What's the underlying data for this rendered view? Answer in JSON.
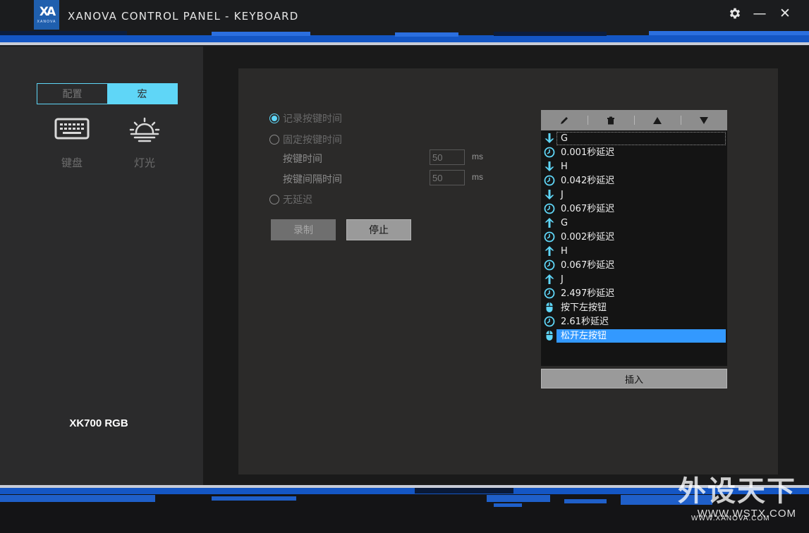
{
  "window": {
    "title": "XANOVA CONTROL PANEL - KEYBOARD",
    "logo_mark": "XA",
    "logo_text": "XANOVA"
  },
  "window_controls": {
    "settings_icon": "gear-icon",
    "minimize_glyph": "—",
    "close_glyph": "✕"
  },
  "sidebar": {
    "tabs": [
      {
        "label": "配置",
        "active": false
      },
      {
        "label": "宏",
        "active": true
      }
    ],
    "nav": [
      {
        "label": "键盘",
        "icon": "keyboard-icon"
      },
      {
        "label": "灯光",
        "icon": "sunrise-icon"
      }
    ],
    "device_name": "XK700 RGB"
  },
  "macro_settings": {
    "options": [
      {
        "label": "记录按键时间",
        "checked": true
      },
      {
        "label": "固定按键时间",
        "checked": false
      },
      {
        "label": "无延迟",
        "checked": false
      }
    ],
    "key_time": {
      "label": "按键时间",
      "value": "50",
      "unit": "ms"
    },
    "key_interval": {
      "label": "按键间隔时间",
      "value": "50",
      "unit": "ms"
    },
    "record_button": "录制",
    "stop_button": "停止"
  },
  "macro_list": {
    "toolbar": [
      "pencil-icon",
      "trash-icon",
      "arrow-up-icon",
      "arrow-down-icon"
    ],
    "items": [
      {
        "type": "down",
        "text": "G"
      },
      {
        "type": "delay",
        "text": "0.001秒延迟"
      },
      {
        "type": "down",
        "text": "H"
      },
      {
        "type": "delay",
        "text": "0.042秒延迟"
      },
      {
        "type": "down",
        "text": "J"
      },
      {
        "type": "delay",
        "text": "0.067秒延迟"
      },
      {
        "type": "up",
        "text": "G"
      },
      {
        "type": "delay",
        "text": "0.002秒延迟"
      },
      {
        "type": "up",
        "text": "H"
      },
      {
        "type": "delay",
        "text": "0.067秒延迟"
      },
      {
        "type": "up",
        "text": "J"
      },
      {
        "type": "delay",
        "text": "2.497秒延迟"
      },
      {
        "type": "mouse",
        "text": "按下左按钮"
      },
      {
        "type": "delay",
        "text": "2.61秒延迟"
      },
      {
        "type": "mouse",
        "text": "松开左按钮"
      }
    ],
    "insert_button": "插入"
  },
  "colors": {
    "accent": "#5fd6f7",
    "brand_blue": "#1456c4",
    "selection": "#3399ff"
  },
  "watermark": {
    "big": "外设天下",
    "url": "WWW.WSTX.COM"
  },
  "brand_url": "WWW.XANOVA.COM"
}
